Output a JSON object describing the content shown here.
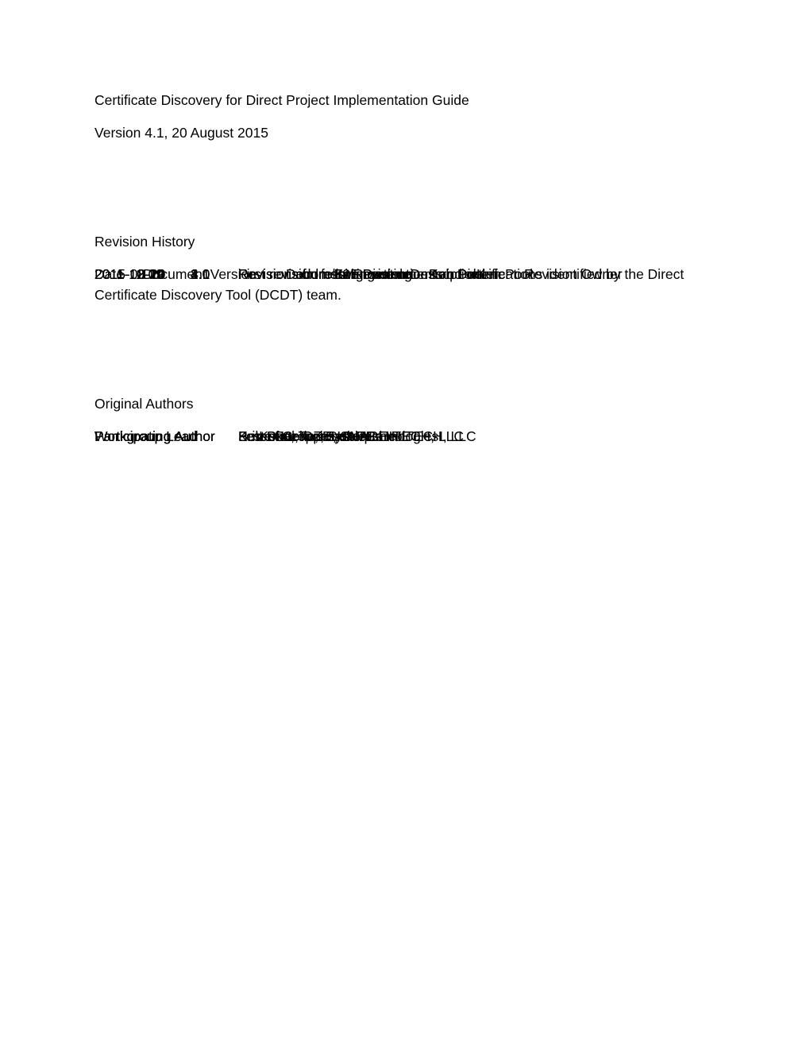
{
  "document": {
    "title": "Certificate Discovery for Direct Project Implementation Guide",
    "version_line": "Version 4.1, 20 August 2015"
  },
  "revision_history": {
    "heading": "Revision History",
    "columns": {
      "date": "Date",
      "document_version": "Document Version",
      "description": "Document Revision Description",
      "owner": "Revision Owner"
    },
    "rows": [
      {
        "date": "2011-10-19",
        "version": "1.1",
        "description": "Revisions from F2F meeting",
        "owner": "Ken Pool"
      },
      {
        "date": "2011-10-24",
        "version": "2.0",
        "description": "Revisions from Bob Dieterle",
        "owner": "Bob Dieterle"
      },
      {
        "date": "2011-11-09",
        "version": "3.0",
        "description": "Revisions from Ken Pool",
        "owner": "Ken Pool"
      },
      {
        "date": "2011-12-14",
        "version": "4.0",
        "description": "First revision following comments",
        "owner": "Ken Pool"
      },
      {
        "date": "2015-08-20",
        "version": "4.1",
        "description": "Revision addressing corrections and clarifications identified by the Direct Certificate Discovery Tool (DCDT) team.",
        "owner": ""
      }
    ]
  },
  "original_authors": {
    "heading": "Original Authors",
    "rows": [
      {
        "role": "Workgroup Lead",
        "name": "Ken Pool, OZ Systems"
      },
      {
        "role": "Workgroup Lead",
        "name": "Sri Koka, Techsant Technologies"
      },
      {
        "role": "Participating Author",
        "name": "Peter Bachman, Cequs Inc."
      },
      {
        "role": "Participating Author",
        "name": "Bob Dieterle, EnableCare"
      },
      {
        "role": "Participating Author",
        "name": "Ernest Grove, SHAPE HITECH, LLC"
      },
      {
        "role": "Participating Author",
        "name": "Lester Keepper, SHAPE HITECH, LLC"
      }
    ]
  }
}
